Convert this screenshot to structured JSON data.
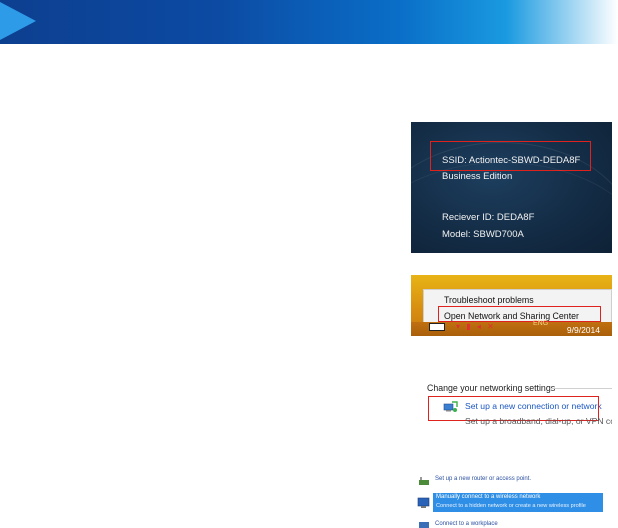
{
  "colors": {
    "header_blue": "#0c4aa3",
    "highlight_red": "#e0221f",
    "link_blue": "#1a56c4",
    "selected_blue": "#2f8fe6"
  },
  "device_screen": {
    "ssid": "SSID:  Actiontec-SBWD-DEDA8F",
    "edition": "Business Edition",
    "receiver_id": "Reciever ID:  DEDA8F",
    "model": "Model: SBWD700A"
  },
  "taskbar_menu": {
    "items": [
      {
        "label": "Troubleshoot problems"
      },
      {
        "label": "Open Network and Sharing Center"
      }
    ],
    "tray_lang": "ENG",
    "date": "9/9/2014"
  },
  "network_settings": {
    "heading": "Change your networking settings",
    "setup_link": "Set up a new connection or network",
    "setup_desc": "Set up a broadband, dial-up, or VPN connection"
  },
  "connection_options": {
    "items": [
      {
        "title": "Set up a new router or access point.",
        "icon": "router-icon"
      },
      {
        "title": "Manually connect to a wireless network",
        "subtitle": "Connect to a hidden network or create a new wireless profile",
        "icon": "wireless-icon",
        "selected": true
      },
      {
        "title": "Connect to a workplace",
        "icon": "workplace-icon"
      }
    ]
  }
}
